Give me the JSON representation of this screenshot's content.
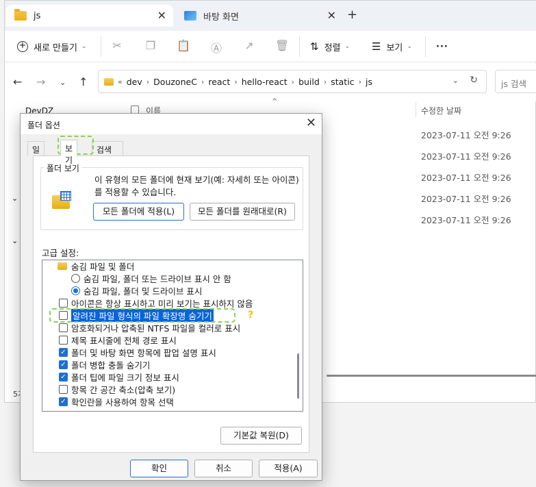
{
  "tabs": [
    {
      "label": "js",
      "active": true
    },
    {
      "label": "바탕 화면",
      "active": false
    }
  ],
  "toolbar": {
    "new_label": "새로 만들기",
    "sort_label": "정렬",
    "view_label": "보기",
    "more_label": "···"
  },
  "address": {
    "overflow": "«",
    "crumbs": [
      "dev",
      "DouzoneC",
      "react",
      "hello-react",
      "build",
      "static",
      "js"
    ],
    "search_placeholder": "js 검색"
  },
  "leftpane": {
    "visible_item": "DevDZ"
  },
  "filelist": {
    "col_name": "이름",
    "col_date": "수정한 날짜",
    "dates": [
      "2023-07-11 오전 9:26",
      "2023-07-11 오전 9:26",
      "2023-07-11 오전 9:26",
      "2023-07-11 오전 9:26",
      "2023-07-11 오전 9:26"
    ]
  },
  "status": {
    "text": "5개"
  },
  "dialog": {
    "title": "폴더 옵션",
    "tabs": [
      "일반",
      "보기",
      "검색"
    ],
    "folder_view": {
      "label": "폴더 보기",
      "description": "이 유형의 모든 폴더에 현재 보기(예: 자세히 또는 아이콘)를 적용할 수 있습니다.",
      "apply_all": "모든 폴더에 적용(L)",
      "reset_all": "모든 폴더를 원래대로(R)"
    },
    "advanced_label": "고급 설정:",
    "settings": [
      {
        "type": "folder",
        "label": "숨김 파일 및 폴더",
        "indent": 0
      },
      {
        "type": "radio",
        "label": "숨김 파일, 폴더 또는 드라이브 표시 안 함",
        "checked": false,
        "indent": 1
      },
      {
        "type": "radio",
        "label": "숨김 파일, 폴더 및 드라이브 표시",
        "checked": true,
        "indent": 1
      },
      {
        "type": "check",
        "label": "아이콘은 항상 표시하고 미리 보기는 표시하지 않음",
        "checked": false,
        "indent": 0
      },
      {
        "type": "check",
        "label": "알려진 파일 형식의 파일 확장명 숨기기",
        "checked": false,
        "indent": 0,
        "highlight": true
      },
      {
        "type": "check",
        "label": "암호화되거나 압축된 NTFS 파일을 컬러로 표시",
        "checked": false,
        "indent": 0
      },
      {
        "type": "check",
        "label": "제목 표시줄에 전체 경로 표시",
        "checked": false,
        "indent": 0
      },
      {
        "type": "check",
        "label": "폴더 및 바탕 화면 항목에 팝업 설명 표시",
        "checked": true,
        "indent": 0
      },
      {
        "type": "check",
        "label": "폴더 병합 충돌 숨기기",
        "checked": true,
        "indent": 0
      },
      {
        "type": "check",
        "label": "폴더 팁에 파일 크기 정보 표시",
        "checked": true,
        "indent": 0
      },
      {
        "type": "check",
        "label": "항목 간 공간 축소(압축 보기)",
        "checked": false,
        "indent": 0
      },
      {
        "type": "check",
        "label": "확인란을 사용하여 항목 선택",
        "checked": true,
        "indent": 0
      }
    ],
    "restore_defaults": "기본값 복원(D)",
    "ok": "확인",
    "cancel": "취소",
    "apply": "적용(A)"
  },
  "annotation": {
    "mark": "?",
    "color": "#f3c300",
    "dash_color": "#8bcf5a"
  }
}
